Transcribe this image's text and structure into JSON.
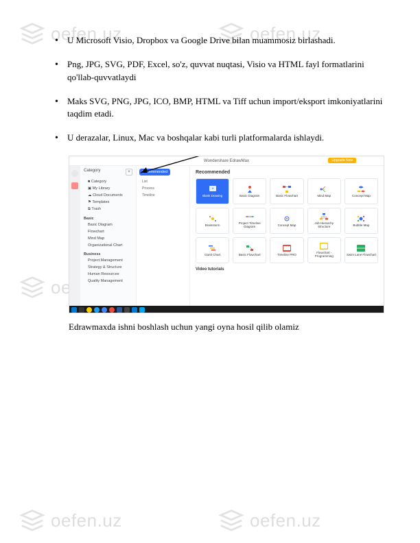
{
  "watermark": {
    "text": "oefen.uz"
  },
  "bullets": [
    "U Microsoft Visio, Dropbox va Google Drive bilan muammosiz birlashadi.",
    "Png, JPG, SVG, PDF, Excel, so'z, quvvat nuqtasi, Visio va HTML fayl formatlarini qo'llab-quvvatlaydi",
    "Maks SVG, PNG, JPG, ICO, BMP, HTML va Tiff uchun import/eksport imkoniyatlarini taqdim etadi.",
    "U derazalar, Linux, Mac va boshqalar kabi turli platformalarda ishlaydi."
  ],
  "screenshot": {
    "title": "Wondershare EdrawMax",
    "upgrade": "Upgrade Now",
    "col2": {
      "category_label": "Category",
      "basic_title": "Basic",
      "basic_items": [
        "Basic Diagram",
        "Flowchart",
        "Mind Map",
        "Organizational Chart"
      ],
      "business_title": "Business",
      "business_items": [
        "Project Management",
        "Strategy & Structure",
        "Human Resources",
        "Quality Management"
      ],
      "bottom_items": [
        "",
        ""
      ]
    },
    "col3": {
      "pill": "Recommended",
      "items": [
        "List",
        "Process",
        "Timeline"
      ]
    },
    "main": {
      "title": "Recommended",
      "cards_row1": [
        "Blank Drawing",
        "Basic Diagram",
        "Basic Flowchart",
        "Mind Map",
        "Concept Map"
      ],
      "cards_row2": [
        "Brainstorm",
        "Project Timeline Diagram",
        "Concept Map",
        "Job Hierarchy Structure",
        "Bubble Map"
      ],
      "cards_row3": [
        "Gantt Chart",
        "Basic Flowchart",
        "Timeline PRO",
        "Flowchart - Programming",
        "Swim Lane Flowchart"
      ],
      "video_title": "Video tutorials"
    }
  },
  "caption": "Edrawmaxda ishni boshlash uchun yangi oyna hosil qilib olamiz"
}
